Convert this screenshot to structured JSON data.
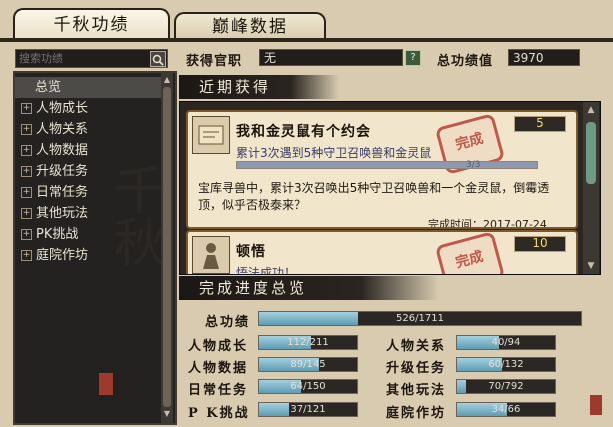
{
  "tabs": [
    {
      "label": "千秋功绩",
      "active": true
    },
    {
      "label": "巅峰数据",
      "active": false
    }
  ],
  "search": {
    "placeholder": "搜索功绩"
  },
  "left_menu": {
    "items": [
      {
        "label": "总览",
        "expandable": false,
        "selected": true
      },
      {
        "label": "人物成长",
        "expandable": true
      },
      {
        "label": "人物关系",
        "expandable": true
      },
      {
        "label": "人物数据",
        "expandable": true
      },
      {
        "label": "升级任务",
        "expandable": true
      },
      {
        "label": "日常任务",
        "expandable": true
      },
      {
        "label": "其他玩法",
        "expandable": true
      },
      {
        "label": "PK挑战",
        "expandable": true
      },
      {
        "label": "庭院作坊",
        "expandable": true
      }
    ]
  },
  "header": {
    "official_label": "获得官职",
    "official_value": "无",
    "help": "?",
    "score_label": "总功绩值",
    "score_value": "3970"
  },
  "recent": {
    "title": "近期获得",
    "cards": [
      {
        "title": "我和金灵鼠有个约会",
        "desc": "累计3次遇到5种守卫召唤兽和金灵鼠",
        "progress": "3/3",
        "progress_fraction": 1.0,
        "badge": "5",
        "stamp": "完成",
        "body": "宝库寻兽中，累计3次召唤出5种守卫召唤兽和一个金灵鼠，倒霉透顶，似乎否极泰来？",
        "date": "完成时间：2017-07-24"
      },
      {
        "title": "顿悟",
        "desc": "悟法成功！",
        "badge": "10",
        "stamp": "完成"
      }
    ]
  },
  "summary": {
    "title": "完成进度总览",
    "total": {
      "label": "总功绩",
      "text": "526/1711",
      "fraction": 0.307
    },
    "rows": [
      {
        "label": "人物成长",
        "text": "112/211",
        "fraction": 0.531
      },
      {
        "label": "人物关系",
        "text": "40/94",
        "fraction": 0.426
      },
      {
        "label": "人物数据",
        "text": "89/145",
        "fraction": 0.614
      },
      {
        "label": "升级任务",
        "text": "60/132",
        "fraction": 0.455
      },
      {
        "label": "日常任务",
        "text": "64/150",
        "fraction": 0.427
      },
      {
        "label": "其他玩法",
        "text": "70/792",
        "fraction": 0.088
      },
      {
        "label": "P K挑战",
        "text": "37/121",
        "fraction": 0.306
      },
      {
        "label": "庭院作坊",
        "text": "34/66",
        "fraction": 0.515
      }
    ]
  }
}
